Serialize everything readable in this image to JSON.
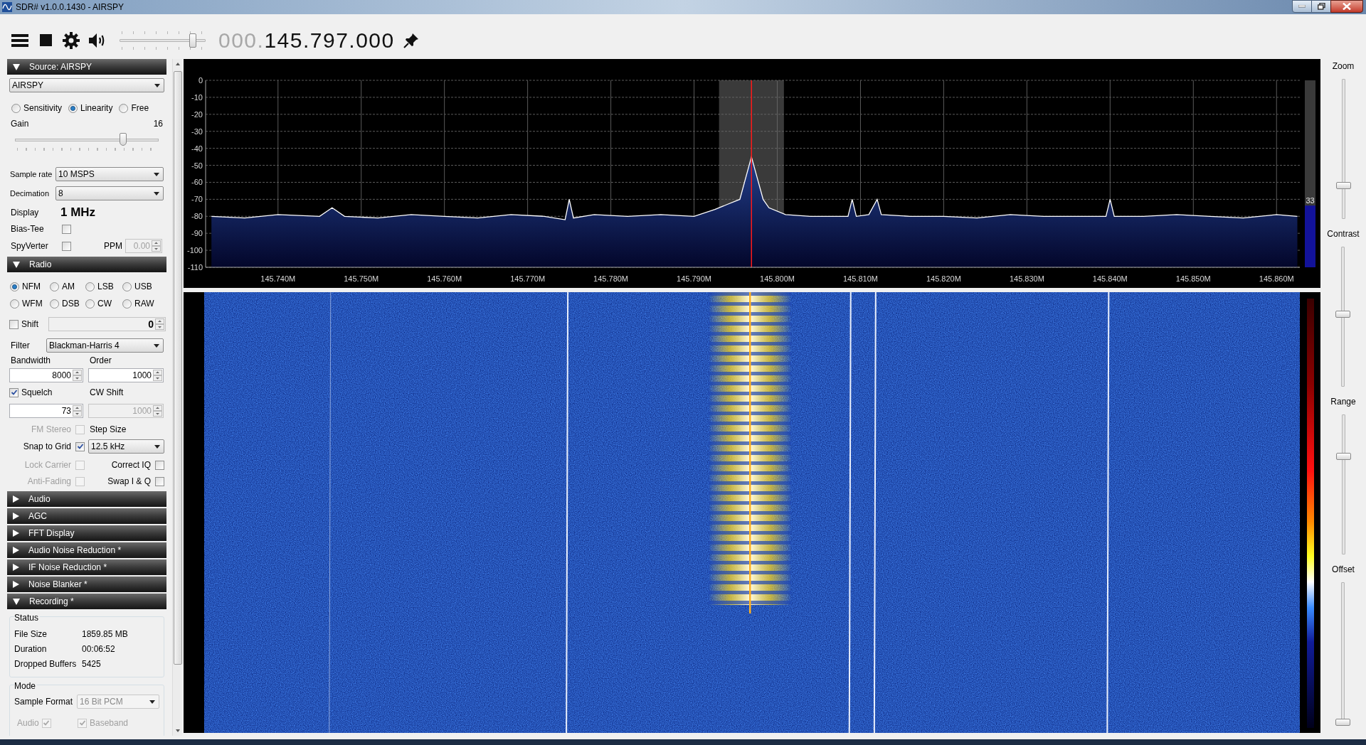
{
  "window": {
    "title": "SDR# v1.0.0.1430 - AIRSPY"
  },
  "toolbar": {
    "volume": {
      "level": 0.85
    },
    "frequency_prefix": "000.",
    "frequency": "145.797.000"
  },
  "panels": [
    {
      "kind": "source",
      "title": "Source: AIRSPY",
      "expanded": true,
      "device": "AIRSPY",
      "modes": [
        {
          "label": "Sensitivity",
          "selected": false
        },
        {
          "label": "Linearity",
          "selected": true
        },
        {
          "label": "Free",
          "selected": false
        }
      ],
      "gain_label": "Gain",
      "gain_value": "16",
      "gain": {
        "level": 0.75
      },
      "sample_rate_label": "Sample rate",
      "sample_rate": "10 MSPS",
      "decimation_label": "Decimation",
      "decimation": "8",
      "display_label": "Display",
      "display_value": "1 MHz",
      "bias_tee": {
        "label": "Bias-Tee",
        "checked": false
      },
      "spyverter": {
        "label": "SpyVerter",
        "checked": false
      },
      "ppm_label": "PPM",
      "ppm": {
        "value": "0.00",
        "disabled": true
      }
    },
    {
      "kind": "radio",
      "title": "Radio",
      "expanded": true,
      "modes": [
        {
          "label": "NFM",
          "selected": true
        },
        {
          "label": "AM",
          "selected": false
        },
        {
          "label": "LSB",
          "selected": false
        },
        {
          "label": "USB",
          "selected": false
        },
        {
          "label": "WFM",
          "selected": false
        },
        {
          "label": "DSB",
          "selected": false
        },
        {
          "label": "CW",
          "selected": false
        },
        {
          "label": "RAW",
          "selected": false
        }
      ],
      "shift": {
        "label": "Shift",
        "checked": false
      },
      "shift_value": {
        "value": "0",
        "disabled": true
      },
      "filter_label": "Filter",
      "filter": "Blackman-Harris 4",
      "bandwidth_label": "Bandwidth",
      "bandwidth": {
        "value": "8000",
        "disabled": false
      },
      "order_label": "Order",
      "order": {
        "value": "1000",
        "disabled": false
      },
      "squelch": {
        "label": "Squelch",
        "checked": true
      },
      "cw_shift_label": "CW Shift",
      "squelch_value": {
        "value": "73",
        "disabled": false
      },
      "cw_shift": {
        "value": "1000",
        "disabled": true
      },
      "fm_stereo": {
        "label": "FM Stereo",
        "checked": false,
        "disabled": true
      },
      "step_size_label": "Step Size",
      "snap_to_grid": {
        "label": "Snap to Grid",
        "checked": true,
        "disabled": false
      },
      "step_size": "12.5 kHz",
      "lock_carrier": {
        "label": "Lock Carrier",
        "checked": false,
        "disabled": true
      },
      "correct_iq": {
        "label": "Correct IQ",
        "checked": false,
        "disabled": false
      },
      "anti_fading": {
        "label": "Anti-Fading",
        "checked": false,
        "disabled": true
      },
      "swap_iq": {
        "label": "Swap I & Q",
        "checked": false,
        "disabled": false
      }
    },
    {
      "kind": "audio",
      "title": "Audio",
      "expanded": false
    },
    {
      "kind": "agc",
      "title": "AGC",
      "expanded": false
    },
    {
      "kind": "fft",
      "title": "FFT Display",
      "expanded": false
    },
    {
      "kind": "audio_nr",
      "title": "Audio Noise Reduction *",
      "expanded": false
    },
    {
      "kind": "if_nr",
      "title": "IF Noise Reduction *",
      "expanded": false
    },
    {
      "kind": "noise_blanker",
      "title": "Noise Blanker *",
      "expanded": false
    },
    {
      "kind": "recording",
      "title": "Recording *",
      "expanded": true,
      "status_title": "Status",
      "status": [
        {
          "label": "File Size",
          "value": "1859.85 MB"
        },
        {
          "label": "Duration",
          "value": "00:06:52"
        },
        {
          "label": "Dropped Buffers",
          "value": "5425"
        }
      ],
      "mode_title": "Mode",
      "sample_format_label": "Sample Format",
      "sample_format": {
        "value": "16 Bit PCM",
        "disabled": true
      },
      "audio": {
        "label": "Audio",
        "checked": true,
        "disabled": true
      },
      "baseband": {
        "label": "Baseband",
        "checked": true,
        "disabled": true
      }
    }
  ],
  "spectrum": {
    "chart_data": {
      "type": "line",
      "grid": true,
      "xlim": [
        145.7313,
        145.8628
      ],
      "ylim": [
        -110,
        0
      ],
      "x": [
        145.732,
        145.736,
        145.74,
        145.745,
        145.7465,
        145.748,
        145.752,
        145.756,
        145.76,
        145.764,
        145.768,
        145.772,
        145.7745,
        145.775,
        145.7755,
        145.778,
        145.782,
        145.786,
        145.79,
        145.7925,
        145.794,
        145.7955,
        145.7969,
        145.7983,
        145.799,
        145.801,
        145.804,
        145.807,
        145.8085,
        145.809,
        145.8095,
        145.811,
        145.812,
        145.8125,
        145.816,
        145.82,
        145.824,
        145.828,
        145.832,
        145.836,
        145.8395,
        145.84,
        145.8405,
        145.844,
        145.848,
        145.852,
        145.856,
        145.86,
        145.8625
      ],
      "series": [
        {
          "color": "#ffffff",
          "values": [
            -80,
            -81,
            -79,
            -80,
            -75,
            -80,
            -81,
            -79,
            -80,
            -81,
            -79,
            -80,
            -82,
            -70,
            -81,
            -79,
            -80,
            -79,
            -80,
            -76,
            -73,
            -70,
            -45,
            -70,
            -75,
            -79,
            -80,
            -80,
            -80,
            -70,
            -80,
            -79,
            -70,
            -79,
            -80,
            -80,
            -81,
            -79,
            -80,
            -80,
            -80,
            -70,
            -80,
            -80,
            -79,
            -80,
            -81,
            -79,
            -80
          ]
        }
      ],
      "xticks": [
        {
          "value": 145.74,
          "label": "145.740M"
        },
        {
          "value": 145.75,
          "label": "145.750M"
        },
        {
          "value": 145.76,
          "label": "145.760M"
        },
        {
          "value": 145.77,
          "label": "145.770M"
        },
        {
          "value": 145.78,
          "label": "145.780M"
        },
        {
          "value": 145.79,
          "label": "145.790M"
        },
        {
          "value": 145.8,
          "label": "145.800M"
        },
        {
          "value": 145.81,
          "label": "145.810M"
        },
        {
          "value": 145.82,
          "label": "145.820M"
        },
        {
          "value": 145.83,
          "label": "145.830M"
        },
        {
          "value": 145.84,
          "label": "145.840M"
        },
        {
          "value": 145.85,
          "label": "145.850M"
        },
        {
          "value": 145.86,
          "label": "145.860M"
        }
      ],
      "yticks": [
        0,
        -10,
        -20,
        -30,
        -40,
        -50,
        -60,
        -70,
        -80,
        -90,
        -100,
        -110
      ],
      "bands": [
        {
          "axis": "x",
          "from": 145.793,
          "to": 145.8008
        }
      ],
      "ref_lines": [
        {
          "axis": "x",
          "value": 145.7969
        }
      ]
    },
    "level_meter": {
      "reading": "33",
      "level": 0.33
    }
  },
  "display_sliders": [
    {
      "label": "Zoom",
      "level": 0.24
    },
    {
      "label": "Contrast",
      "level": 0.52
    },
    {
      "label": "Range",
      "level": 0.7
    },
    {
      "label": "Offset",
      "level": 0.0
    }
  ]
}
